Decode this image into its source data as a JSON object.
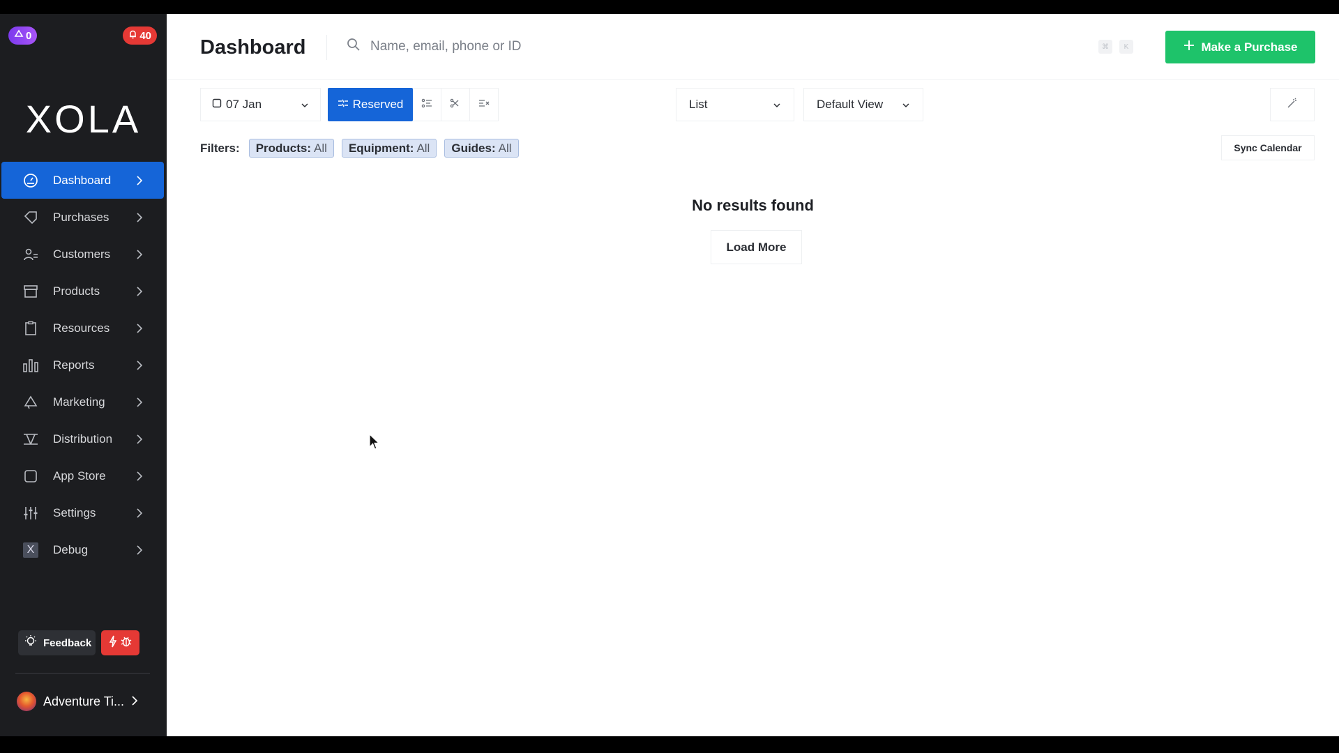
{
  "badges": {
    "notifications_purple": "0",
    "alerts_red": "40"
  },
  "brand": {
    "logo": "XOLA"
  },
  "nav": [
    {
      "label": "Dashboard",
      "icon": "dashboard-icon",
      "active": true
    },
    {
      "label": "Purchases",
      "icon": "tag-icon"
    },
    {
      "label": "Customers",
      "icon": "users-icon"
    },
    {
      "label": "Products",
      "icon": "box-icon"
    },
    {
      "label": "Resources",
      "icon": "clipboard-icon"
    },
    {
      "label": "Reports",
      "icon": "bar-chart-icon"
    },
    {
      "label": "Marketing",
      "icon": "megaphone-icon"
    },
    {
      "label": "Distribution",
      "icon": "distribution-icon"
    },
    {
      "label": "App Store",
      "icon": "app-store-icon"
    },
    {
      "label": "Settings",
      "icon": "sliders-icon"
    },
    {
      "label": "Debug",
      "icon": "debug-x-icon",
      "icon_text": "X"
    }
  ],
  "feedback": {
    "label": "Feedback"
  },
  "account": {
    "name": "Adventure Ti..."
  },
  "header": {
    "title": "Dashboard",
    "search_placeholder": "Name, email, phone or ID",
    "shortcut_keys": [
      "⌘",
      "K"
    ],
    "purchase_button": "Make a Purchase"
  },
  "toolbar": {
    "date": "07 Jan",
    "status_filter": "Reserved",
    "view_mode": "List",
    "saved_view": "Default View"
  },
  "filters": {
    "label": "Filters:",
    "chips": [
      {
        "key": "Products:",
        "value": "All"
      },
      {
        "key": "Equipment:",
        "value": "All"
      },
      {
        "key": "Guides:",
        "value": "All"
      }
    ],
    "sync_button": "Sync Calendar"
  },
  "results": {
    "empty_message": "No results found",
    "load_more": "Load More"
  },
  "colors": {
    "sidebar_bg": "#1c1d20",
    "accent_blue": "#1565d8",
    "purchase_green": "#1ec36a",
    "badge_red": "#e53935",
    "badge_purple": "#8b3cf0"
  }
}
